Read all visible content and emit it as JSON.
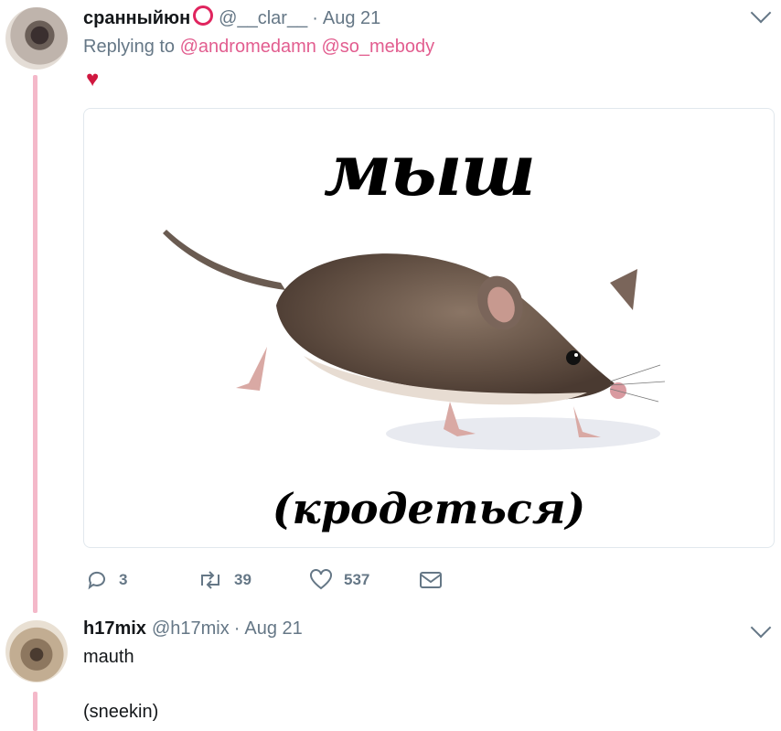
{
  "tweet1": {
    "name": "сранныйюн",
    "handle": "@__clar__",
    "separator": "·",
    "date": "Aug 21",
    "replying_prefix": "Replying to",
    "mentions": [
      "@andromedamn",
      "@so_mebody"
    ],
    "emoji": "♥",
    "image": {
      "title": "мыш",
      "caption": "(кродеться)"
    },
    "actions": {
      "reply_count": "3",
      "retweet_count": "39",
      "like_count": "537"
    }
  },
  "tweet2": {
    "name": "h17mix",
    "handle": "@h17mix",
    "separator": "·",
    "date": "Aug 21",
    "line1": "mauth",
    "line2": "(sneekin)"
  },
  "colors": {
    "thread_line": "#f4b8c9",
    "mention": "#e25d8f",
    "secondary_text": "#657786",
    "heart": "#d0173f"
  }
}
